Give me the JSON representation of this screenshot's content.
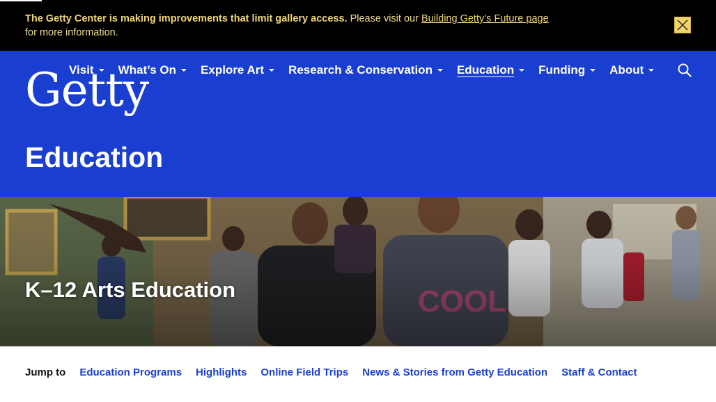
{
  "alert": {
    "bold_text": "The Getty Center is making improvements that limit gallery access.",
    "text_before_link": " Please visit our ",
    "link_text": "Building Getty’s Future page",
    "text_after_link": "for more information.",
    "close_icon": "close-icon"
  },
  "header": {
    "logo_text": "Getty",
    "nav": [
      {
        "label": "Visit",
        "active": false
      },
      {
        "label": "What’s On",
        "active": false
      },
      {
        "label": "Explore Art",
        "active": false
      },
      {
        "label": "Research & Conservation",
        "active": false
      },
      {
        "label": "Education",
        "active": true
      },
      {
        "label": "Funding",
        "active": false
      },
      {
        "label": "About",
        "active": false
      }
    ],
    "search_icon": "search-icon",
    "page_title": "Education"
  },
  "hero": {
    "title": "K–12 Arts Education",
    "image": "students-in-museum-gallery-photo"
  },
  "jump_to": {
    "label": "Jump to",
    "links": [
      "Education Programs",
      "Highlights",
      "Online Field Trips",
      "News & Stories from Getty Education",
      "Staff & Contact"
    ]
  },
  "colors": {
    "brand_blue": "#1a3fd0",
    "alert_bg": "#000000",
    "alert_text": "#f2d77a",
    "close_button": "#f3d46b"
  }
}
